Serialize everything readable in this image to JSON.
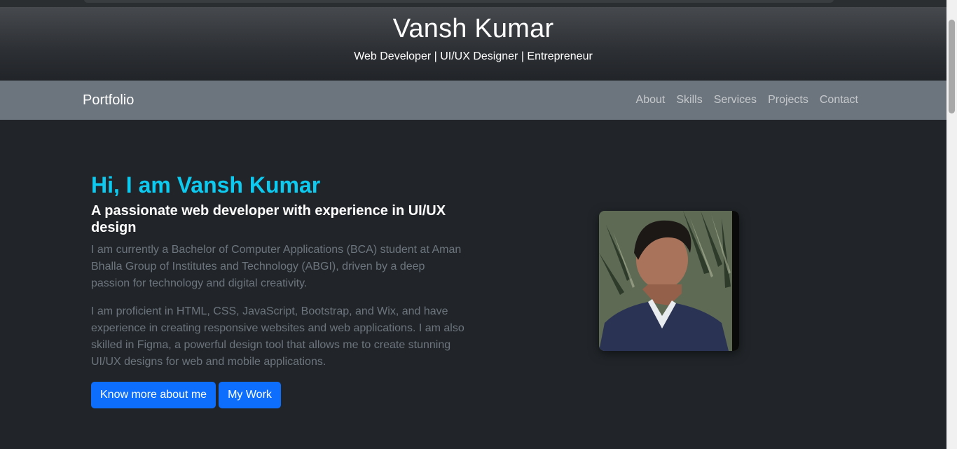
{
  "header": {
    "title": "Vansh Kumar",
    "tagline": "Web Developer | UI/UX Designer | Entrepreneur"
  },
  "navbar": {
    "brand": "Portfolio",
    "links": [
      "About",
      "Skills",
      "Services",
      "Projects",
      "Contact"
    ]
  },
  "about": {
    "heading": "Hi, I am Vansh Kumar",
    "subheading": "A passionate web developer with experience in UI/UX design",
    "paragraph1": "I am currently a Bachelor of Computer Applications (BCA) student at Aman Bhalla Group of Institutes and Technology (ABGI), driven by a deep passion for technology and digital creativity.",
    "paragraph2": "I am proficient in HTML, CSS, JavaScript, Bootstrap, and Wix, and have experience in creating responsive websites and web applications. I am also skilled in Figma, a powerful design tool that allows me to create stunning UI/UX designs for web and mobile applications.",
    "button_more": "Know more about me",
    "button_work": "My Work"
  },
  "colors": {
    "accent": "#0dcaf0",
    "primary_button": "#0d6efd",
    "navbar_bg": "#6c757d",
    "page_bg": "#212529"
  }
}
